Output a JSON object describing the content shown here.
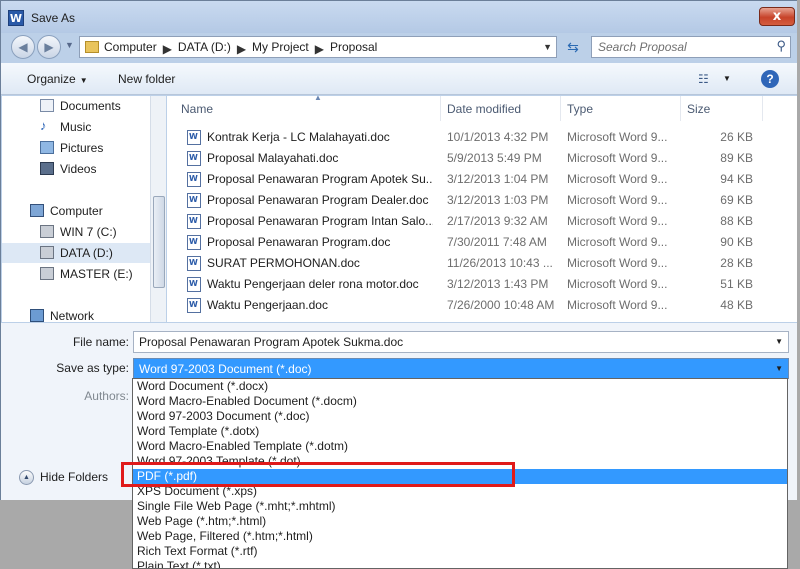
{
  "window": {
    "title": "Save As",
    "app_icon_letter": "W",
    "close_glyph": "x"
  },
  "address_bar": {
    "crumbs": [
      "Computer",
      "DATA (D:)",
      "My Project",
      "Proposal"
    ],
    "search_placeholder": "Search Proposal"
  },
  "toolbar": {
    "organize_label": "Organize",
    "new_folder_label": "New folder",
    "help_glyph": "?"
  },
  "navigation": {
    "items": [
      {
        "label": "Documents",
        "icon": "documents-icon"
      },
      {
        "label": "Music",
        "icon": "music-icon"
      },
      {
        "label": "Pictures",
        "icon": "pictures-icon"
      },
      {
        "label": "Videos",
        "icon": "videos-icon"
      },
      {
        "label": "Computer",
        "icon": "computer-icon"
      },
      {
        "label": "WIN 7 (C:)",
        "icon": "drive-icon"
      },
      {
        "label": "DATA (D:)",
        "icon": "drive-icon",
        "selected": true
      },
      {
        "label": "MASTER (E:)",
        "icon": "drive-icon"
      },
      {
        "label": "Network",
        "icon": "network-icon"
      }
    ]
  },
  "file_list": {
    "columns": {
      "name": "Name",
      "date": "Date modified",
      "type": "Type",
      "size": "Size"
    },
    "rows": [
      {
        "name": "Kontrak Kerja - LC Malahayati.doc",
        "date": "10/1/2013 4:32 PM",
        "type": "Microsoft Word 9...",
        "size": "26 KB"
      },
      {
        "name": "Proposal Malayahati.doc",
        "date": "5/9/2013 5:49 PM",
        "type": "Microsoft Word 9...",
        "size": "89 KB"
      },
      {
        "name": "Proposal Penawaran Program Apotek Su...",
        "date": "3/12/2013 1:04 PM",
        "type": "Microsoft Word 9...",
        "size": "94 KB"
      },
      {
        "name": "Proposal Penawaran Program Dealer.doc",
        "date": "3/12/2013 1:03 PM",
        "type": "Microsoft Word 9...",
        "size": "69 KB"
      },
      {
        "name": "Proposal Penawaran Program Intan Salo...",
        "date": "2/17/2013 9:32 AM",
        "type": "Microsoft Word 9...",
        "size": "88 KB"
      },
      {
        "name": "Proposal Penawaran Program.doc",
        "date": "7/30/2011 7:48 AM",
        "type": "Microsoft Word 9...",
        "size": "90 KB"
      },
      {
        "name": "SURAT PERMOHONAN.doc",
        "date": "11/26/2013 10:43 ...",
        "type": "Microsoft Word 9...",
        "size": "28 KB"
      },
      {
        "name": "Waktu Pengerjaan deler rona motor.doc",
        "date": "3/12/2013 1:43 PM",
        "type": "Microsoft Word 9...",
        "size": "51 KB"
      },
      {
        "name": "Waktu Pengerjaan.doc",
        "date": "7/26/2000 10:48 AM",
        "type": "Microsoft Word 9...",
        "size": "48 KB"
      }
    ]
  },
  "form": {
    "file_name_label": "File name:",
    "file_name_value": "Proposal Penawaran Program Apotek Sukma.doc",
    "save_as_type_label": "Save as type:",
    "save_as_type_value": "Word 97-2003 Document (*.doc)",
    "authors_label": "Authors:",
    "hide_folders_label": "Hide Folders"
  },
  "type_options": [
    "Word Document (*.docx)",
    "Word Macro-Enabled Document (*.docm)",
    "Word 97-2003 Document (*.doc)",
    "Word Template (*.dotx)",
    "Word Macro-Enabled Template (*.dotm)",
    "Word 97-2003 Template (*.dot)",
    "PDF (*.pdf)",
    "XPS Document (*.xps)",
    "Single File Web Page (*.mht;*.mhtml)",
    "Web Page (*.htm;*.html)",
    "Web Page, Filtered (*.htm;*.html)",
    "Rich Text Format (*.rtf)",
    "Plain Text (*.txt)"
  ],
  "highlighted_option_index": 6,
  "colors": {
    "selection": "#3399ff",
    "annotation_box": "#e01a1a",
    "chrome": "#bcd0e8"
  }
}
